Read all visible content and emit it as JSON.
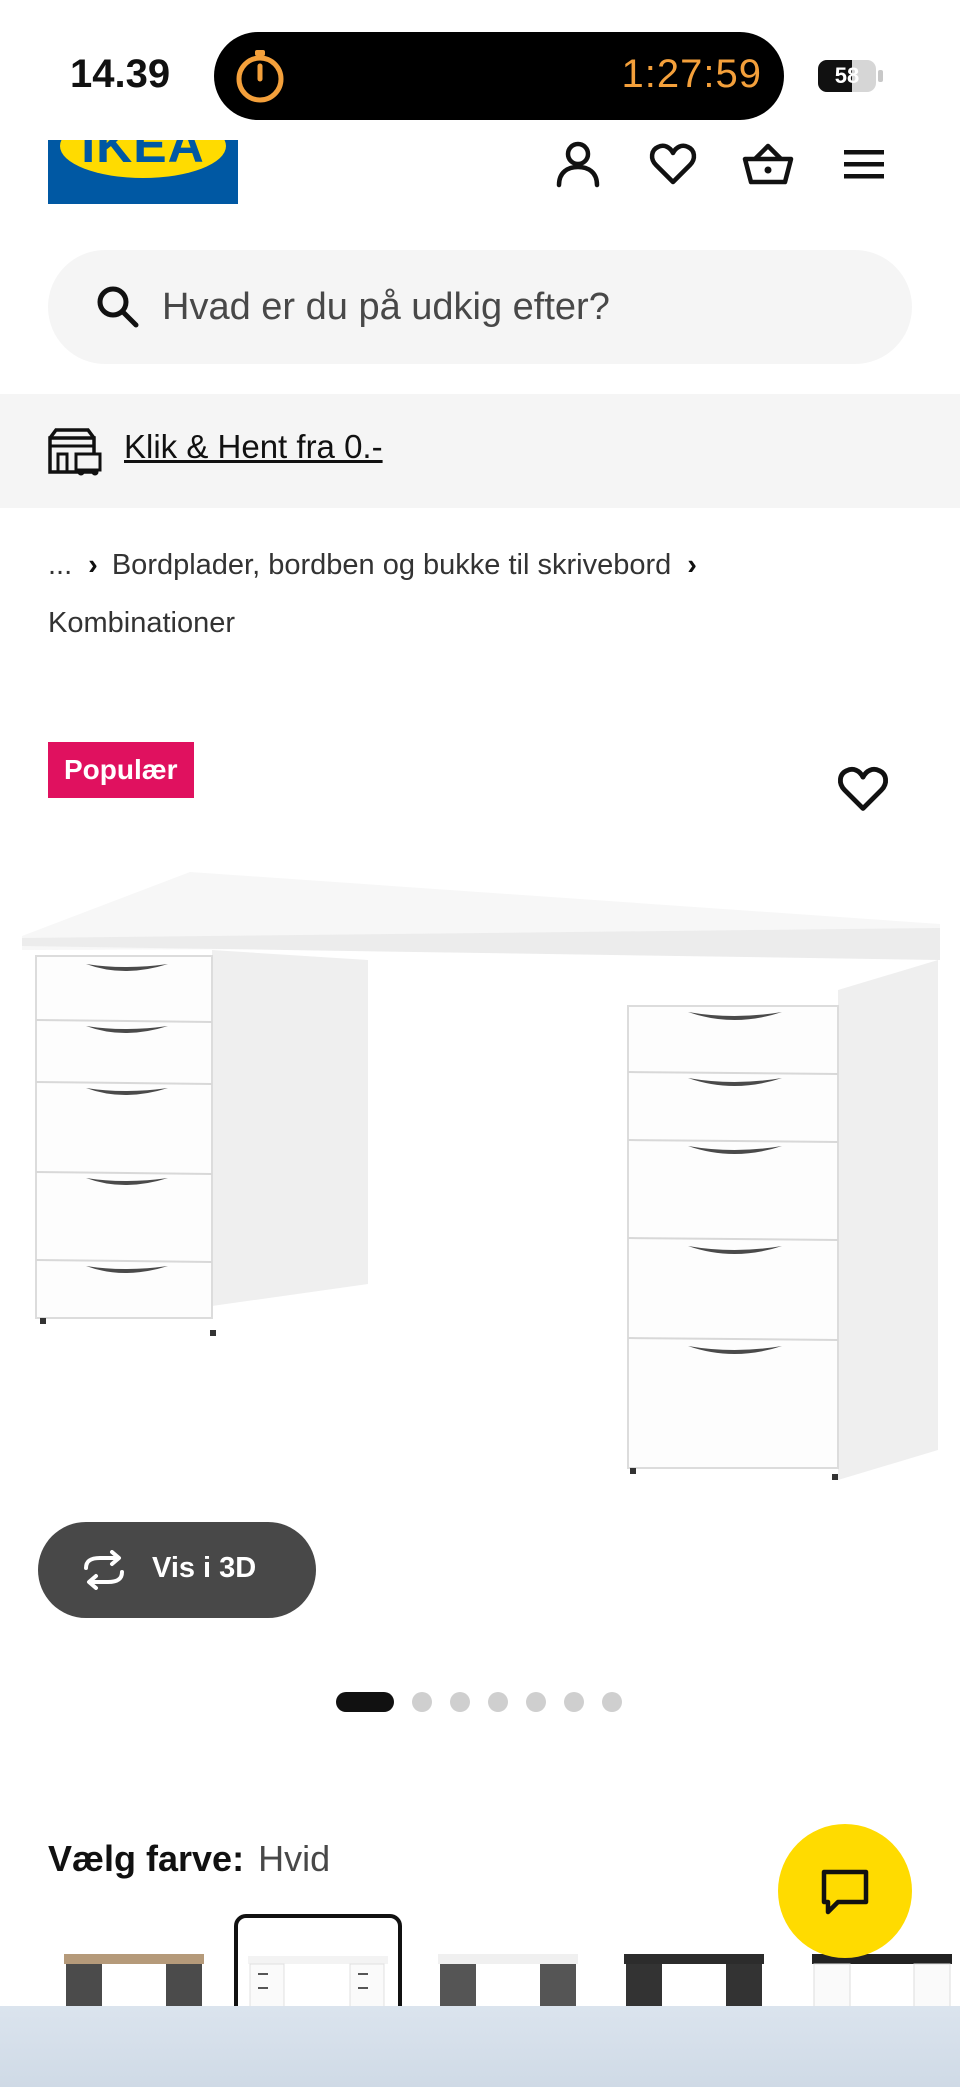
{
  "status_bar": {
    "time": "14.39",
    "timer": "1:27:59",
    "battery_level": "58",
    "battery_fraction": 0.58
  },
  "header": {
    "logo_text": "IKEA",
    "icons": [
      "user-icon",
      "heart-icon",
      "basket-icon",
      "menu-icon"
    ]
  },
  "search": {
    "placeholder": "Hvad er du på udkig efter?"
  },
  "click_collect": {
    "link_text": "Klik & Hent fra 0.-"
  },
  "breadcrumb": {
    "ellipsis": "...",
    "level1": "Bordplader, bordben og bukke til skrivebord",
    "level2": "Kombinationer"
  },
  "product": {
    "badge": "Populær",
    "view_3d_label": "Vis i 3D",
    "image_count": 7,
    "active_image_index": 0
  },
  "color_selector": {
    "label": "Vælg farve:",
    "value": "Hvid",
    "options": [
      "grey-black-with-wood",
      "white",
      "grey-white",
      "black",
      "white-black"
    ]
  },
  "colors": {
    "ikea_blue": "#0058a3",
    "ikea_yellow": "#ffdb00",
    "badge_pink": "#e0115f",
    "timer_orange": "#f4a03b"
  }
}
